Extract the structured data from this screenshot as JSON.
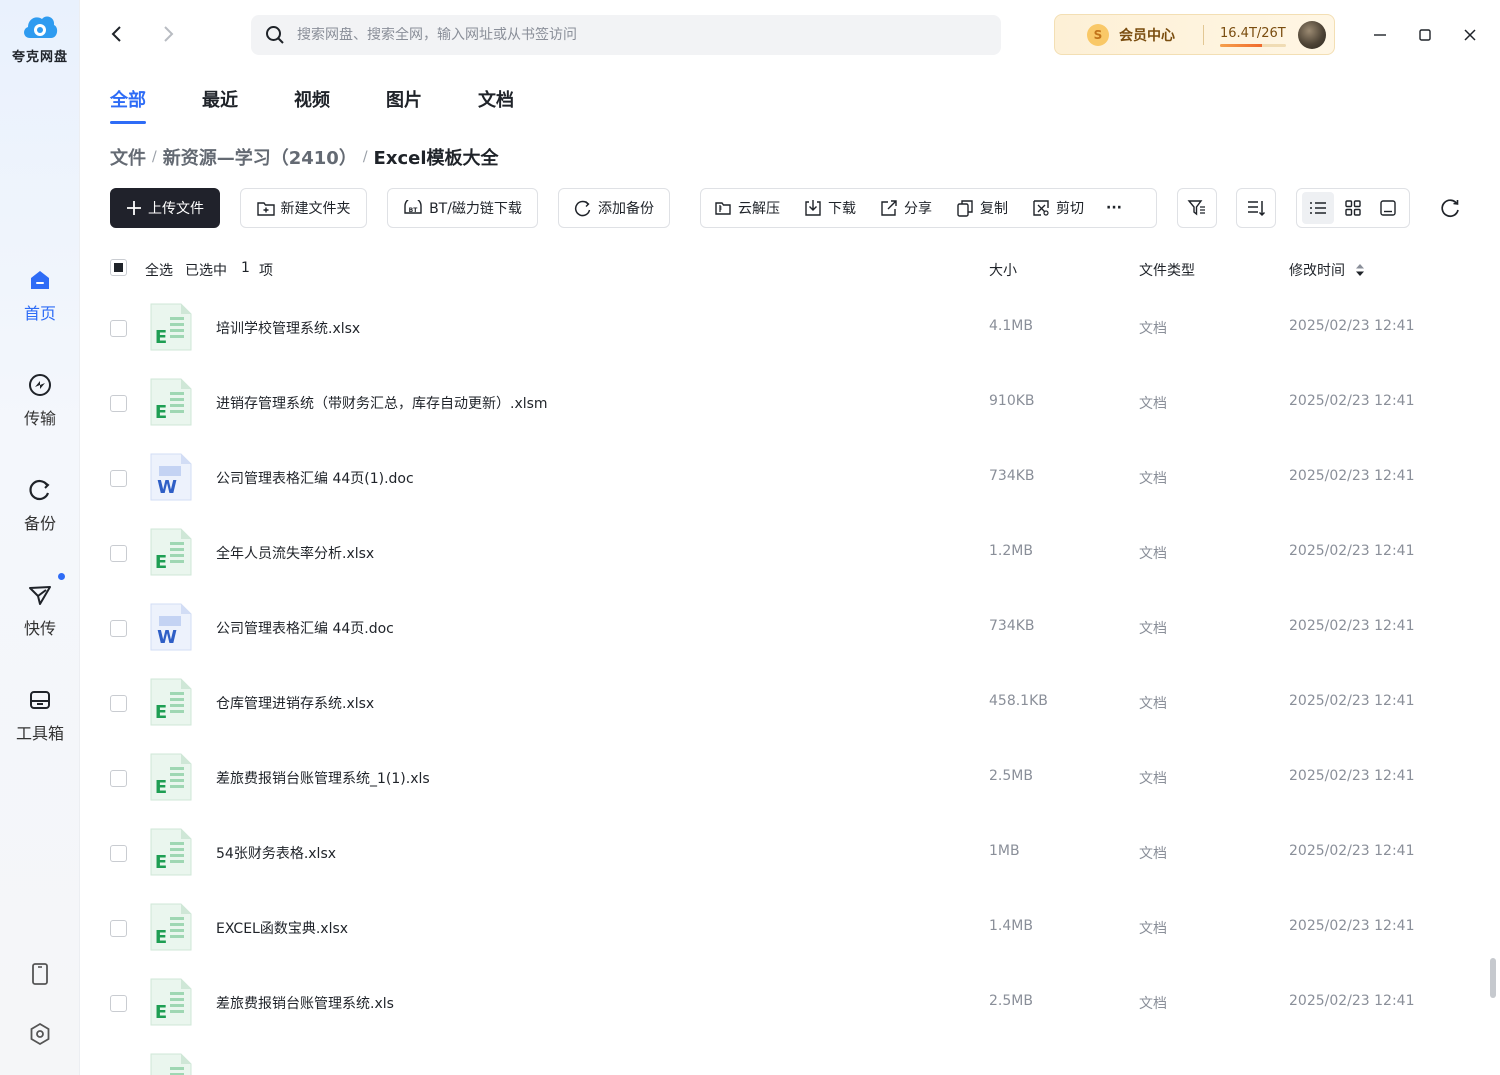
{
  "app": {
    "name": "夸克网盘"
  },
  "sidebar": {
    "items": [
      {
        "label": "首页",
        "icon": "home-icon",
        "active": true
      },
      {
        "label": "传输",
        "icon": "transfer-icon"
      },
      {
        "label": "备份",
        "icon": "backup-icon"
      },
      {
        "label": "快传",
        "icon": "quick-send-icon",
        "badge": true
      },
      {
        "label": "工具箱",
        "icon": "toolbox-icon"
      }
    ],
    "bottom": [
      "phone-icon",
      "settings-icon"
    ]
  },
  "search": {
    "placeholder": "搜索网盘、搜索全网，输入网址或从书签访问"
  },
  "vip": {
    "label": "会员中心",
    "coin": "S",
    "quota": "16.4T/26T",
    "used_fraction": 0.63
  },
  "tabs": [
    {
      "label": "全部",
      "active": true
    },
    {
      "label": "最近"
    },
    {
      "label": "视频"
    },
    {
      "label": "图片"
    },
    {
      "label": "文档"
    }
  ],
  "breadcrumb": [
    {
      "label": "文件"
    },
    {
      "label": "新资源—学习（2410）"
    },
    {
      "label": "Excel模板大全",
      "current": true
    }
  ],
  "toolbar": {
    "upload": "上传文件",
    "new_folder": "新建文件夹",
    "bt_download": "BT/磁力链下载",
    "add_backup": "添加备份",
    "group": [
      {
        "label": "云解压",
        "icon": "unzip-icon"
      },
      {
        "label": "下载",
        "icon": "download-icon"
      },
      {
        "label": "分享",
        "icon": "share-icon"
      },
      {
        "label": "复制",
        "icon": "copy-icon"
      },
      {
        "label": "剪切",
        "icon": "cut-icon"
      }
    ],
    "more": "···"
  },
  "list_header": {
    "select_all": "全选",
    "selected_prefix": "已选中",
    "selected_count": "1",
    "selected_suffix": "项",
    "size": "大小",
    "type": "文件类型",
    "modified": "修改时间"
  },
  "files": [
    {
      "name": "培训学校管理系统.xlsx",
      "kind": "excel",
      "size": "4.1MB",
      "type": "文档",
      "time": "2025/02/23 12:41"
    },
    {
      "name": "进销存管理系统（带财务汇总，库存自动更新）.xlsm",
      "kind": "excel",
      "size": "910KB",
      "type": "文档",
      "time": "2025/02/23 12:41"
    },
    {
      "name": "公司管理表格汇编 44页(1).doc",
      "kind": "word",
      "size": "734KB",
      "type": "文档",
      "time": "2025/02/23 12:41"
    },
    {
      "name": "全年人员流失率分析.xlsx",
      "kind": "excel",
      "size": "1.2MB",
      "type": "文档",
      "time": "2025/02/23 12:41"
    },
    {
      "name": "公司管理表格汇编 44页.doc",
      "kind": "word",
      "size": "734KB",
      "type": "文档",
      "time": "2025/02/23 12:41"
    },
    {
      "name": "仓库管理进销存系统.xlsx",
      "kind": "excel",
      "size": "458.1KB",
      "type": "文档",
      "time": "2025/02/23 12:41"
    },
    {
      "name": "差旅费报销台账管理系统_1(1).xls",
      "kind": "excel",
      "size": "2.5MB",
      "type": "文档",
      "time": "2025/02/23 12:41"
    },
    {
      "name": "54张财务表格.xlsx",
      "kind": "excel",
      "size": "1MB",
      "type": "文档",
      "time": "2025/02/23 12:41"
    },
    {
      "name": "EXCEL函数宝典.xlsx",
      "kind": "excel",
      "size": "1.4MB",
      "type": "文档",
      "time": "2025/02/23 12:41"
    },
    {
      "name": "差旅费报销台账管理系统.xls",
      "kind": "excel",
      "size": "2.5MB",
      "type": "文档",
      "time": "2025/02/23 12:41"
    }
  ],
  "colors": {
    "accent": "#2e6cf6",
    "excel": "#1e9e53",
    "word": "#2f5fc6"
  }
}
